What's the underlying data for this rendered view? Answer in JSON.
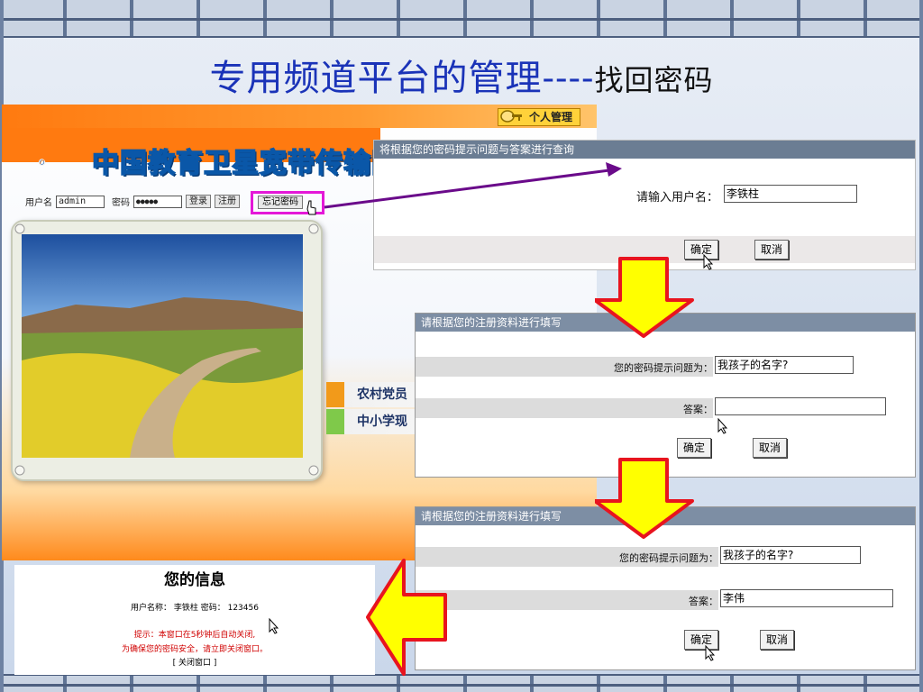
{
  "slide": {
    "title_main": "专用频道平台的管理----",
    "title_sub": "找回密码"
  },
  "portal": {
    "personal_mgmt": "个人管理",
    "logo_text": "中国教育卫星宽带传输网",
    "login": {
      "user_label": "用户名",
      "user_value": "admin",
      "password_label": "密码",
      "password_value": "●●●●●",
      "login_btn": "登录",
      "register_btn": "注册",
      "forgot_btn": "忘记密码"
    },
    "tabs": [
      {
        "label": "农村党员",
        "color": "#f29a1a"
      },
      {
        "label": "中小学现",
        "color": "#7fc94a"
      }
    ]
  },
  "query_panel": {
    "header": "将根据您的密码提示问题与答案进行查询",
    "username_label": "请输入用户名：",
    "username_value": "李铁柱",
    "ok_btn": "确定",
    "cancel_btn": "取消"
  },
  "register_panel_1": {
    "header": "请根据您的注册资料进行填写",
    "question_label": "您的密码提示问题为：",
    "question_value": "我孩子的名字?",
    "answer_label": "答案：",
    "answer_value": "",
    "ok_btn": "确定",
    "cancel_btn": "取消"
  },
  "register_panel_2": {
    "header": "请根据您的注册资料进行填写",
    "question_label": "您的密码提示问题为：",
    "question_value": "我孩子的名字?",
    "answer_label": "答案：",
    "answer_value": "李伟",
    "ok_btn": "确定",
    "cancel_btn": "取消"
  },
  "info_panel": {
    "title": "您的信息",
    "user_line": "用户名称： 李铁柱      密码： 123456",
    "tip_line": "提示：本窗口在5秒钟后自动关闭,",
    "safety_line": "为确保您的密码安全，请立即关闭窗口。",
    "close_link": "[ 关闭窗口 ]"
  },
  "colors": {
    "title_blue": "#1a33b8",
    "highlight_magenta": "#e418d8",
    "connector_purple": "#6a0a8a",
    "arrow_yellow": "#ffff00",
    "arrow_red": "#e8141e"
  }
}
